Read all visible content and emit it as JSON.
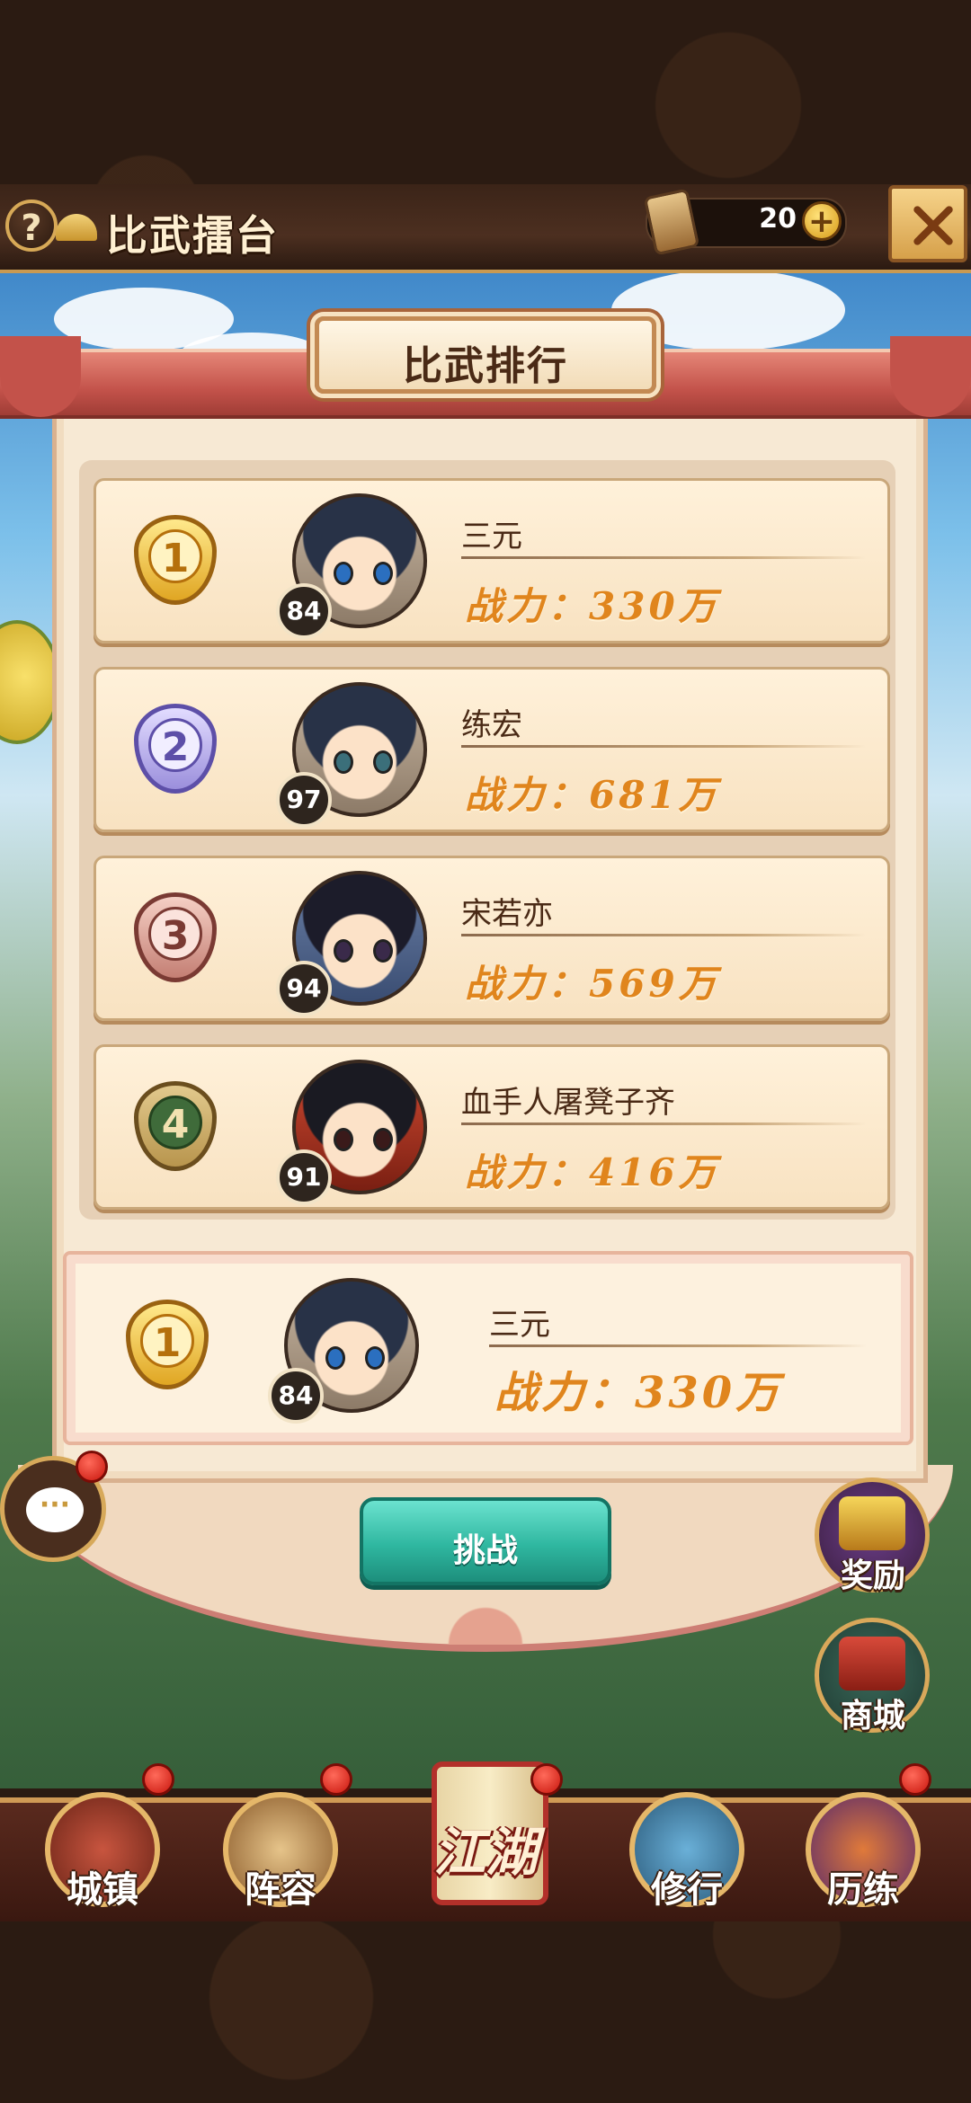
{
  "header": {
    "help_label": "?",
    "title": "比武擂台",
    "currency_value": "20",
    "plus_label": "+"
  },
  "panel": {
    "banner_title": "比武排行"
  },
  "rankings": [
    {
      "rank": "1",
      "level": "84",
      "name": "三元",
      "power": "战力：330万",
      "medal_color": "gold"
    },
    {
      "rank": "2",
      "level": "97",
      "name": "练宏",
      "power": "战力：681万",
      "medal_color": "purple"
    },
    {
      "rank": "3",
      "level": "94",
      "name": "宋若亦",
      "power": "战力：569万",
      "medal_color": "bronze"
    },
    {
      "rank": "4",
      "level": "91",
      "name": "血手人屠凳子齐",
      "power": "战力：416万",
      "medal_color": "green"
    }
  ],
  "self_rank": {
    "rank": "1",
    "level": "84",
    "name": "三元",
    "power": "战力：330万"
  },
  "actions": {
    "challenge_label": "挑战"
  },
  "side_buttons": {
    "reward_label": "奖励",
    "shop_label": "商城"
  },
  "bottom_nav": [
    {
      "label": "城镇"
    },
    {
      "label": "阵容"
    },
    {
      "label": "江湖"
    },
    {
      "label": "修行"
    },
    {
      "label": "历练"
    }
  ],
  "chat": {
    "icon_text": "···"
  },
  "colors": {
    "accent_gold": "#e0851d",
    "panel_bg": "#f7e9d4",
    "challenge_teal": "#2fb7a0",
    "notification_red": "#c8160d"
  }
}
